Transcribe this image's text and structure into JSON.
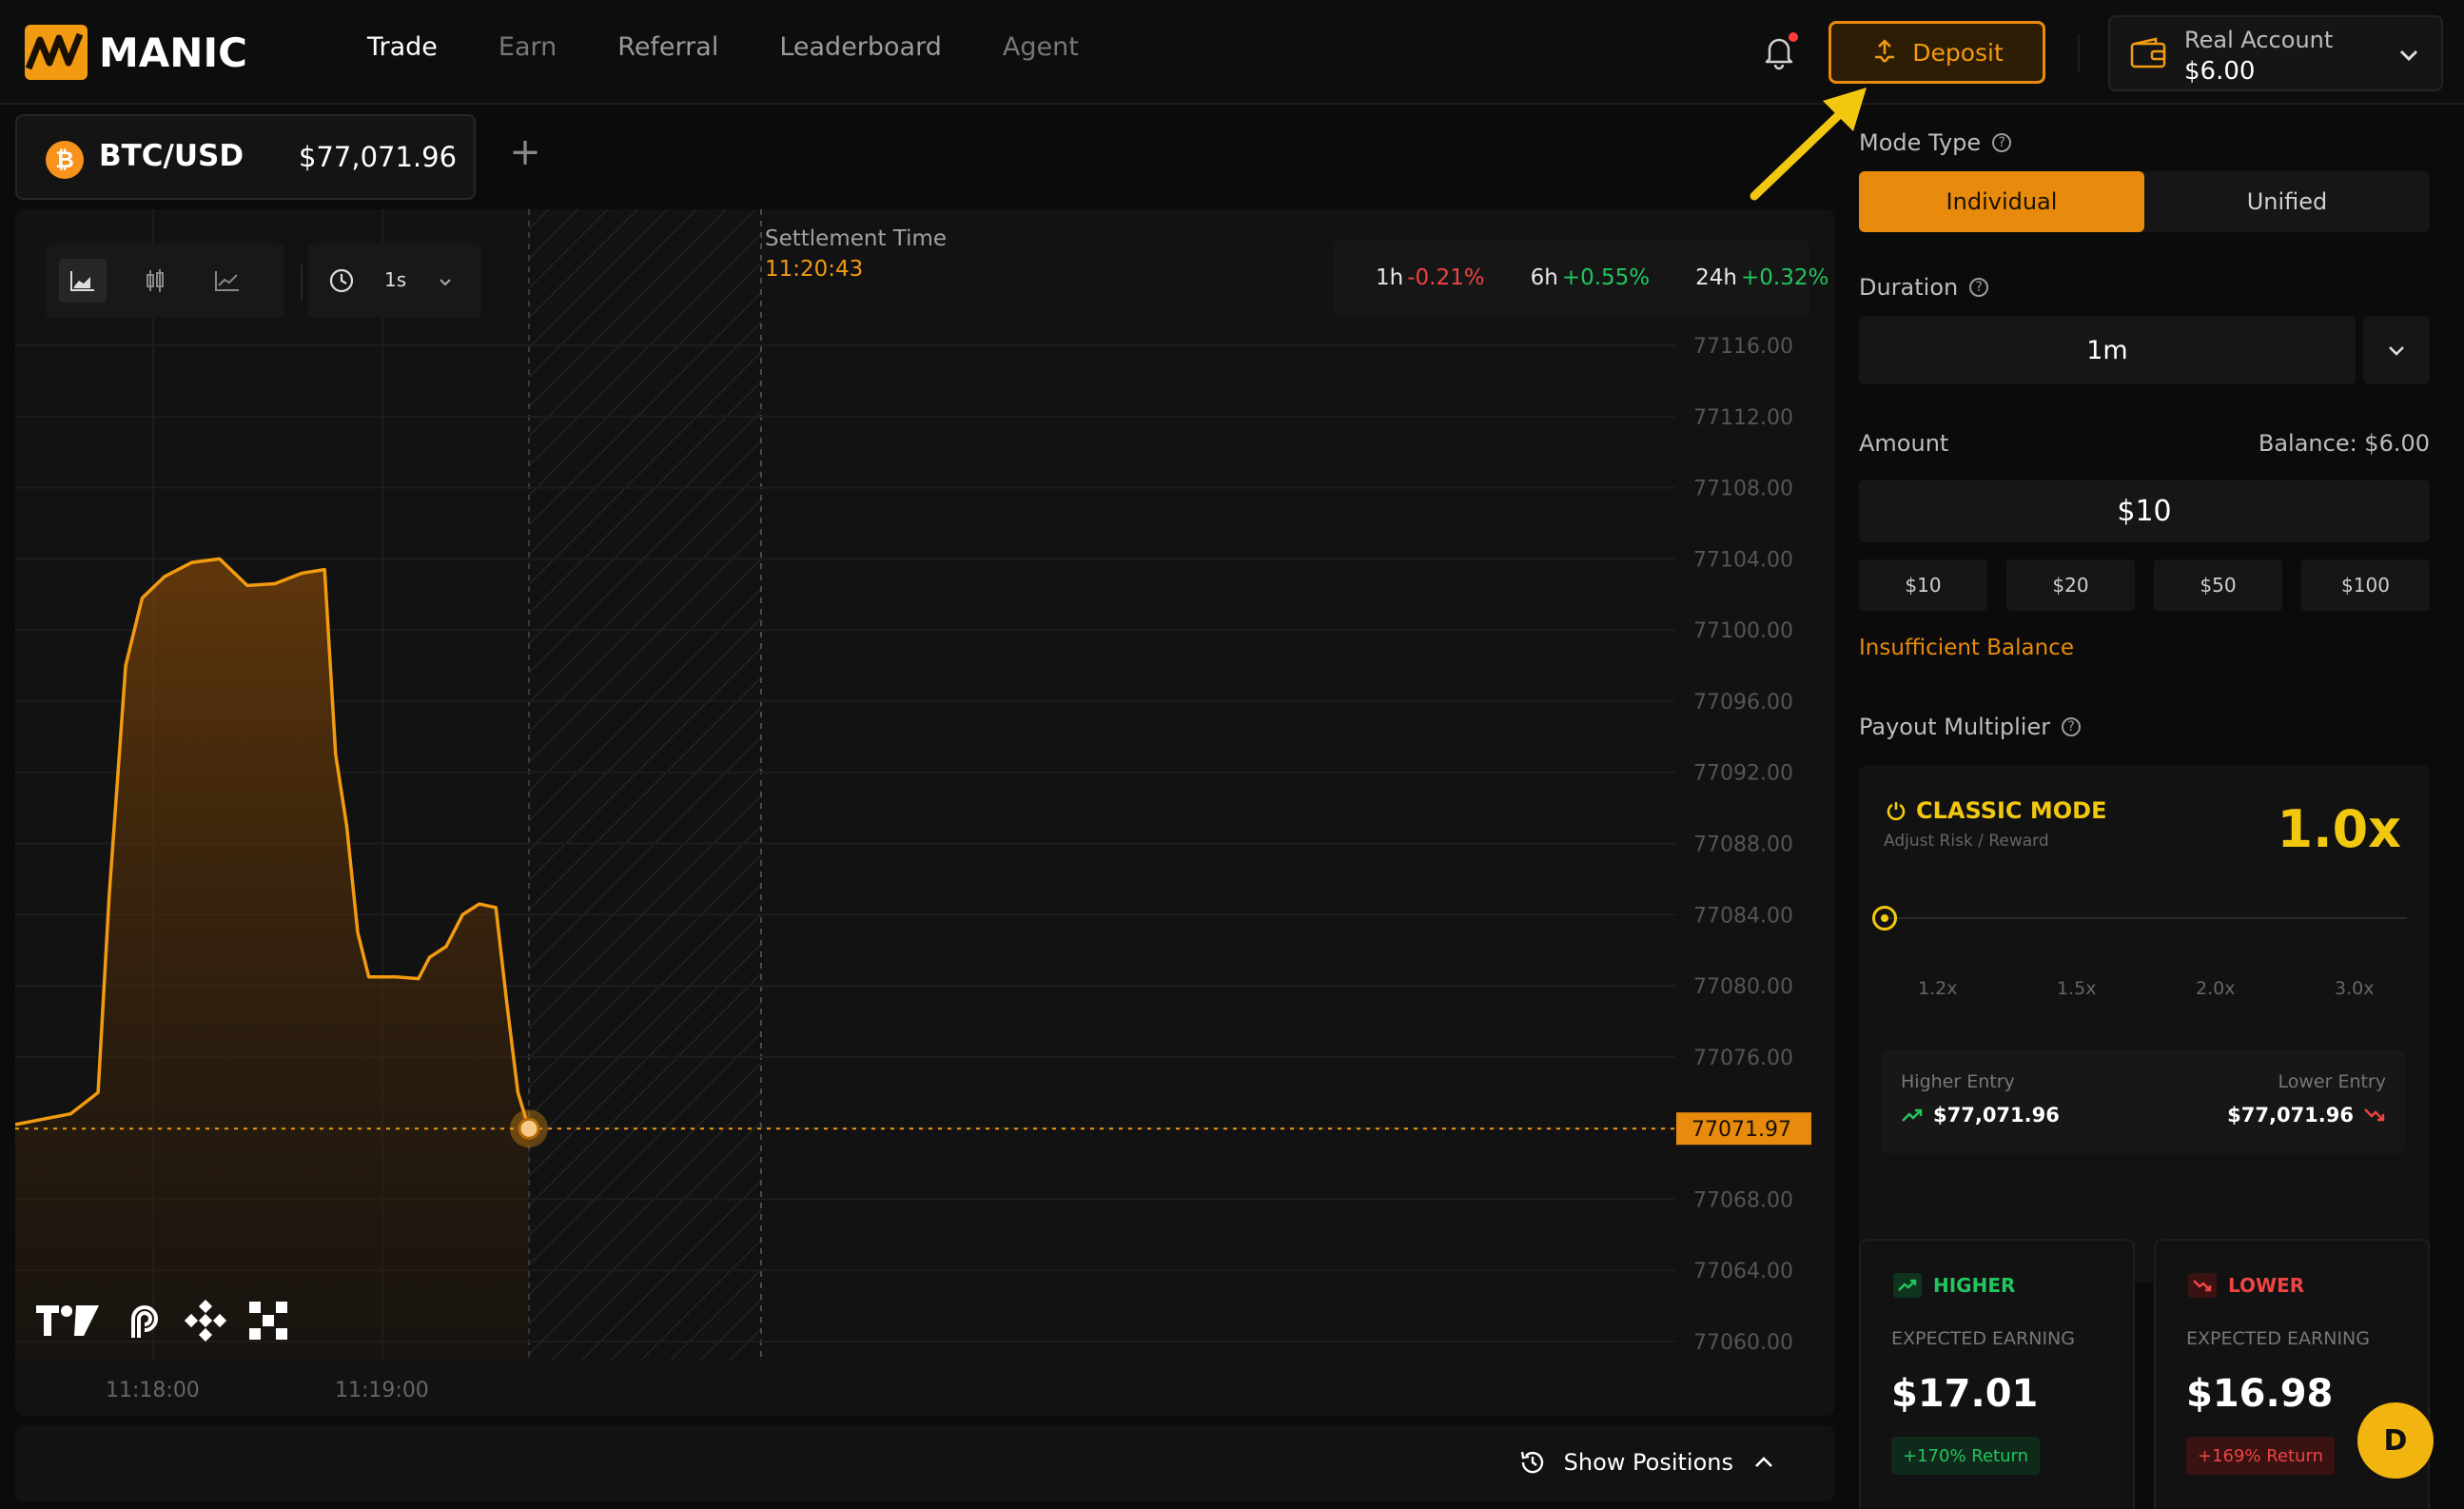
{
  "header": {
    "logo_text": "MANIC",
    "nav": [
      {
        "label": "Trade"
      },
      {
        "label": "Earn"
      },
      {
        "label": "Referral"
      },
      {
        "label": "Leaderboard"
      },
      {
        "label": "Agent"
      }
    ],
    "deposit_label": "Deposit",
    "account": {
      "label": "Real Account",
      "balance": "$6.00"
    }
  },
  "pair_tab": {
    "symbol_glyph": "₿",
    "name": "BTC/USD",
    "price": "$77,071.96",
    "add_label": "+"
  },
  "chart": {
    "interval": "1s",
    "settlement_label": "Settlement Time",
    "settlement_time": "11:20:43",
    "changes": [
      {
        "label": "1h",
        "value": "-0.21%",
        "color": "#ef4444"
      },
      {
        "label": "6h",
        "value": "+0.55%",
        "color": "#22c55e"
      },
      {
        "label": "24h",
        "value": "+0.32%",
        "color": "#22c55e"
      }
    ],
    "current_price_label": "77071.97"
  },
  "chart_data": {
    "type": "area",
    "ylim": [
      77058,
      77118
    ],
    "y_ticks": [
      "77116.00",
      "77112.00",
      "77108.00",
      "77104.00",
      "77100.00",
      "77096.00",
      "77092.00",
      "77088.00",
      "77084.00",
      "77080.00",
      "77076.00",
      "77072.00",
      "77068.00",
      "77064.00",
      "77060.00"
    ],
    "x_ticks": [
      "11:18:00",
      "11:19:00"
    ],
    "x_seconds_visible": [
      0,
      80
    ],
    "series": [
      {
        "points_t_value": [
          [
            0,
            77072.2
          ],
          [
            10,
            77072.8
          ],
          [
            15,
            77074.0
          ],
          [
            17,
            77085.0
          ],
          [
            20,
            77098.0
          ],
          [
            23,
            77101.8
          ],
          [
            27,
            77103.0
          ],
          [
            32,
            77103.8
          ],
          [
            37,
            77104.0
          ],
          [
            42,
            77102.5
          ],
          [
            47,
            77102.6
          ],
          [
            52,
            77103.2
          ],
          [
            56,
            77103.4
          ],
          [
            58,
            77093.0
          ],
          [
            60,
            77089.0
          ],
          [
            62,
            77083.0
          ],
          [
            64,
            77080.5
          ],
          [
            69,
            77080.5
          ],
          [
            73,
            77080.4
          ],
          [
            75,
            77081.6
          ],
          [
            78,
            77082.2
          ],
          [
            81,
            77084.0
          ],
          [
            84,
            77084.6
          ],
          [
            87,
            77084.4
          ],
          [
            89,
            77079.0
          ],
          [
            91,
            77074.0
          ],
          [
            93,
            77071.97
          ]
        ],
        "color": "#f29a10"
      }
    ],
    "reference_line": 77071.97
  },
  "positions_bar": {
    "label": "Show Positions"
  },
  "panel": {
    "mode_type_label": "Mode Type",
    "modes": [
      "Individual",
      "Unified"
    ],
    "duration_label": "Duration",
    "duration_value": "1m",
    "amount_label": "Amount",
    "balance_text": "Balance: $6.00",
    "amount_value": "$10",
    "quick_amounts": [
      "$10",
      "$20",
      "$50",
      "$100"
    ],
    "insufficient": "Insufficient Balance",
    "payout_label": "Payout Multiplier",
    "classic_mode": "CLASSIC MODE",
    "classic_sub": "Adjust Risk / Reward",
    "multiplier": "1.0x",
    "slider_ticks": [
      "1.2x",
      "1.5x",
      "2.0x",
      "3.0x"
    ],
    "higher_entry_label": "Higher Entry",
    "lower_entry_label": "Lower Entry",
    "higher_entry_value": "$77,071.96",
    "lower_entry_value": "$77,071.96",
    "higher": {
      "title": "HIGHER",
      "sub": "EXPECTED EARNING",
      "value": "$17.01",
      "badge": "+170% Return",
      "color": "#22c55e"
    },
    "lower": {
      "title": "LOWER",
      "sub": "EXPECTED EARNING",
      "value": "$16.98",
      "badge": "+169% Return",
      "color": "#ef4444"
    },
    "avatar_letter": "D"
  }
}
